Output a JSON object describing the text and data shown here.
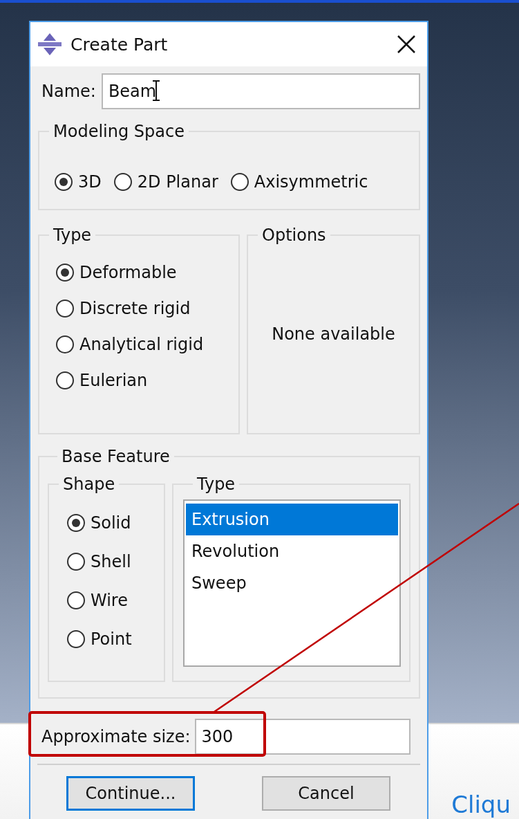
{
  "window": {
    "title": "Create Part"
  },
  "name": {
    "label": "Name:",
    "value": "Beam"
  },
  "modeling_space": {
    "title": "Modeling Space",
    "options": [
      {
        "label": "3D",
        "selected": true
      },
      {
        "label": "2D Planar",
        "selected": false
      },
      {
        "label": "Axisymmetric",
        "selected": false
      }
    ]
  },
  "type": {
    "title": "Type",
    "options": [
      {
        "label": "Deformable",
        "selected": true
      },
      {
        "label": "Discrete rigid",
        "selected": false
      },
      {
        "label": "Analytical rigid",
        "selected": false
      },
      {
        "label": "Eulerian",
        "selected": false
      }
    ]
  },
  "options": {
    "title": "Options",
    "message": "None available"
  },
  "base_feature": {
    "title": "Base Feature",
    "shape": {
      "title": "Shape",
      "options": [
        {
          "label": "Solid",
          "selected": true
        },
        {
          "label": "Shell",
          "selected": false
        },
        {
          "label": "Wire",
          "selected": false
        },
        {
          "label": "Point",
          "selected": false
        }
      ]
    },
    "type": {
      "title": "Type",
      "items": [
        {
          "label": "Extrusion",
          "selected": true
        },
        {
          "label": "Revolution",
          "selected": false
        },
        {
          "label": "Sweep",
          "selected": false
        }
      ]
    }
  },
  "approximate_size": {
    "label": "Approximate size:",
    "value": "300"
  },
  "buttons": [
    {
      "label": "Continue...",
      "default": true
    },
    {
      "label": "Cancel",
      "default": false
    }
  ],
  "background_link": "Cliqu"
}
